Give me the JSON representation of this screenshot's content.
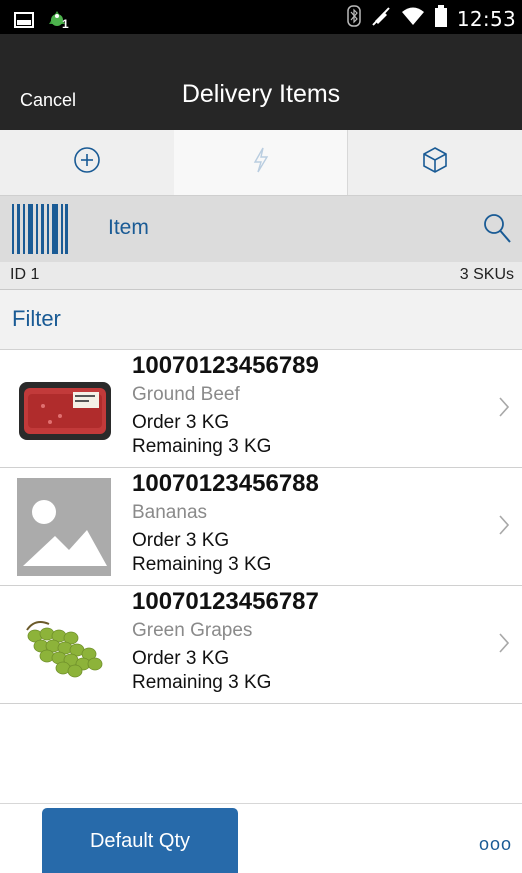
{
  "status_bar": {
    "time": "12:53",
    "icons": [
      "image-icon",
      "notification-app-icon",
      "bluetooth-icon",
      "mute-icon",
      "wifi-icon",
      "battery-icon"
    ],
    "badge": "1"
  },
  "header": {
    "cancel_label": "Cancel",
    "title": "Delivery Items"
  },
  "tabs": [
    {
      "icon": "add-circle-icon",
      "active": false
    },
    {
      "icon": "lightning-icon",
      "active": true
    },
    {
      "icon": "box-icon",
      "active": false
    }
  ],
  "scan": {
    "label": "Item",
    "icons": [
      "barcode-icon",
      "search-icon"
    ]
  },
  "summary": {
    "id_text": "ID 1",
    "count_text": "3 SKUs"
  },
  "filter": {
    "label": "Filter"
  },
  "items": [
    {
      "sku": "10070123456789",
      "description": "Ground Beef",
      "order": "Order  3  KG",
      "remaining": "Remaining  3  KG",
      "image": "ground-beef-image"
    },
    {
      "sku": "10070123456788",
      "description": "Bananas",
      "order": "Order  3  KG",
      "remaining": "Remaining  3  KG",
      "image": "placeholder-image"
    },
    {
      "sku": "10070123456787",
      "description": "Green Grapes",
      "order": "Order  3  KG",
      "remaining": "Remaining  3  KG",
      "image": "green-grapes-image"
    }
  ],
  "footer": {
    "default_qty_label": "Default Qty",
    "more_label": "ooo"
  },
  "colors": {
    "accent": "#1a5b95",
    "button": "#276aaa",
    "title_bar": "#262626"
  }
}
